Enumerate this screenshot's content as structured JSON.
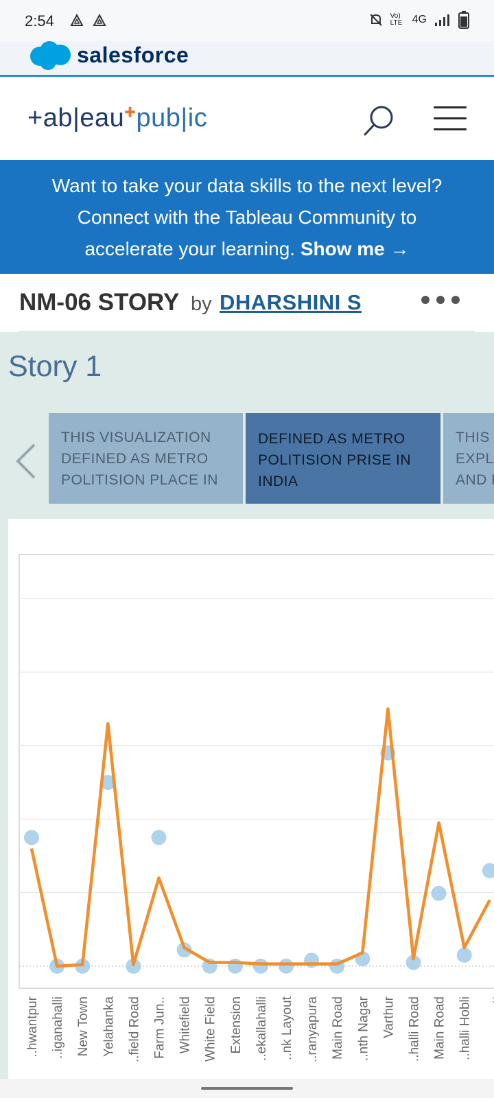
{
  "status_bar": {
    "time": "2:54",
    "icons": [
      "alert-triangle-icon",
      "alert-triangle-icon"
    ],
    "network": "4G",
    "volte": "Vo) LTE",
    "right_icons": [
      "bell-off-icon",
      "volte-icon",
      "signal-icon",
      "battery-icon"
    ]
  },
  "salesforce": {
    "brand": "salesforce",
    "brand_color": "#00a1e0"
  },
  "tableau": {
    "logo_left": "+ab|eau",
    "logo_right": "pub|ic",
    "search_icon": "search-icon",
    "menu_icon": "hamburger-menu-icon"
  },
  "banner": {
    "line1": "Want to take your data skills to the next level?",
    "line2": "Connect with the Tableau Community to",
    "line3": "accelerate your learning.",
    "cta": "Show me →",
    "bg_color": "#1b74c2"
  },
  "viz": {
    "title": "NM-06 STORY",
    "by": "by",
    "author": "DHARSHINI S",
    "more_icon": "more-horizontal-icon"
  },
  "story": {
    "title": "Story 1",
    "prev_icon": "chevron-left-icon",
    "points": [
      {
        "line1": "THIS VISUALIZATION",
        "line2": "DEFINED AS METRO",
        "line3": "POLITISION PLACE IN"
      },
      {
        "line1": "DEFINED AS METRO",
        "line2": "POLITISION PRISE IN",
        "line3": "INDIA"
      },
      {
        "line1": "THIS V",
        "line2": "EXPLA",
        "line3": "AND P"
      }
    ]
  },
  "chart_data": {
    "type": "line",
    "line_color": "#f28e2b",
    "dot_color": "#a0cbe8",
    "categories": [
      "..hwantpur",
      "..iganahalli",
      "New Town",
      "Yelahanka",
      "..field Road",
      "Farm Jun..",
      "Whitefield",
      "White Field",
      "Extension",
      "..ekallahalli",
      "..nk Layout",
      "..ranyapura",
      "Main Road",
      "..nth Nagar",
      "Varthur",
      "..halli Road",
      "Main Road",
      "..halli Hobli",
      ".."
    ],
    "series": [
      {
        "values": [
          1.6,
          0.0,
          0.02,
          3.3,
          0.02,
          1.2,
          0.25,
          0.05,
          0.05,
          0.03,
          0.03,
          0.03,
          0.03,
          0.18,
          3.5,
          0.1,
          1.95,
          0.25,
          0.9
        ]
      },
      {
        "values": [
          1.75,
          0.0,
          0.0,
          2.5,
          0.0,
          1.75,
          0.22,
          0.0,
          0.0,
          0.0,
          0.0,
          0.08,
          0.0,
          0.1,
          2.9,
          0.05,
          0.99,
          0.15,
          1.3
        ]
      }
    ],
    "ylim": [
      -0.3,
      5.6
    ],
    "gridlines": [
      1,
      2,
      3,
      4,
      5
    ],
    "grid": true
  }
}
